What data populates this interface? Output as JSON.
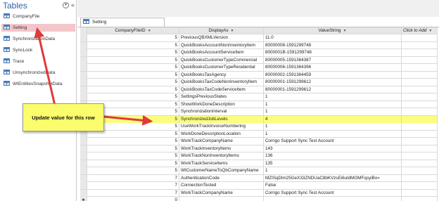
{
  "nav": {
    "title": "Tables",
    "items": [
      {
        "label": "CompanyFile",
        "selected": false
      },
      {
        "label": "Setting",
        "selected": true
      },
      {
        "label": "SynchronizationData",
        "selected": false
      },
      {
        "label": "SyncLock",
        "selected": false
      },
      {
        "label": "Trace",
        "selected": false
      },
      {
        "label": "UnsynchronizedData",
        "selected": false
      },
      {
        "label": "WtEntitiesSnapshotData",
        "selected": false
      }
    ]
  },
  "tab": {
    "label": "Setting"
  },
  "grid": {
    "columns": [
      "CompanyFileID",
      "DisplayAs",
      "ValueString",
      "Click to Add"
    ],
    "rows": [
      {
        "id": "5",
        "display_as": "PreviousQBXMLVersion",
        "value": "11.0"
      },
      {
        "id": "5",
        "display_as": "QuickBooksAccountNonInventoryItem",
        "value": "80000008-1591299748"
      },
      {
        "id": "5",
        "display_as": "QuickBooksAccountServiceItem",
        "value": "8000001B-1591299748"
      },
      {
        "id": "5",
        "display_as": "QuickBooksCustomerTypeCommercial",
        "value": "80000005-1591364387"
      },
      {
        "id": "5",
        "display_as": "QuickBooksCustomerTypeResidential",
        "value": "80000006-1591364396"
      },
      {
        "id": "5",
        "display_as": "QuickBooksTaxAgency",
        "value": "80000002-1591364459"
      },
      {
        "id": "5",
        "display_as": "QuickBooksTaxCodeNonInventoryItem",
        "value": "80000001-1591299612"
      },
      {
        "id": "5",
        "display_as": "QuickBooksTaxCodeServiceItem",
        "value": "80000001-1591299612"
      },
      {
        "id": "5",
        "display_as": "SettingsPreviousStates",
        "value": "1"
      },
      {
        "id": "5",
        "display_as": "ShowWorkDoneDescription",
        "value": "1"
      },
      {
        "id": "5",
        "display_as": "SynchronizationInterval",
        "value": "1"
      },
      {
        "id": "5",
        "display_as": "SynchronizedJobLevels",
        "value": "4",
        "highlight": true
      },
      {
        "id": "5",
        "display_as": "UseWorkTrackInvoiceNumbering",
        "value": "1"
      },
      {
        "id": "5",
        "display_as": "WorkDoneDescriptionLocation",
        "value": "1"
      },
      {
        "id": "5",
        "display_as": "WorkTrackCompanyName",
        "value": "Corrigo Support Sync Test Account"
      },
      {
        "id": "5",
        "display_as": "WorkTrackInventoryItems",
        "value": "143"
      },
      {
        "id": "5",
        "display_as": "WorkTrackNonInventoryItems",
        "value": "136"
      },
      {
        "id": "5",
        "display_as": "WorkTrackServiceItems",
        "value": "135"
      },
      {
        "id": "5",
        "display_as": "WtCustomerNameToQbCompanyName",
        "value": "1"
      },
      {
        "id": "7",
        "display_as": "AuthenticationCode",
        "value": "MZISqDlm25GeX33ZNDUaC8bKVzsEi6uldMOMFqsyiBo="
      },
      {
        "id": "7",
        "display_as": "ConnectionTested",
        "value": "False"
      },
      {
        "id": "7",
        "display_as": "WorkTrackCompanyName",
        "value": "Corrigo Support Sync Test Account"
      },
      {
        "id": "0",
        "display_as": "",
        "value": "",
        "new_record": true
      }
    ]
  },
  "callout": {
    "text": "Update value for this row"
  },
  "colors": {
    "accent_title": "#2d64a8",
    "selected_nav": "#f4c6c9",
    "highlight": "#fbfd7f",
    "callout_fill": "#fbfd6c",
    "arrow": "#e03a3a"
  }
}
